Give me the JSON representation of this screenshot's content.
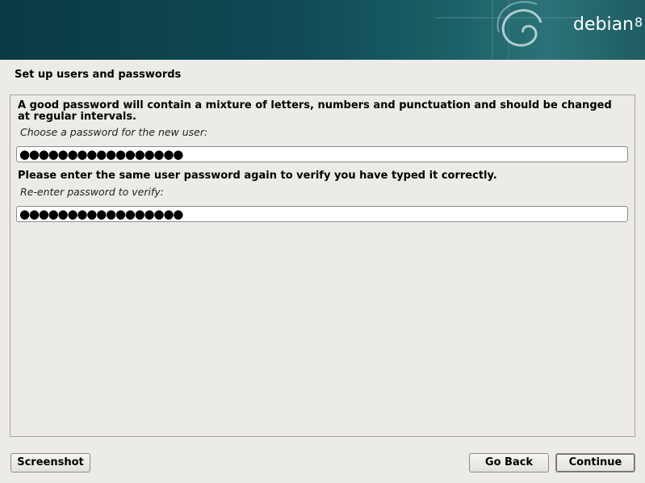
{
  "header": {
    "brand": "debian",
    "version": "8"
  },
  "page": {
    "title": "Set up users and passwords"
  },
  "form": {
    "password_hint": "A good password will contain a mixture of letters, numbers and punctuation and should be changed at regular intervals.",
    "password_prompt": "Choose a password for the new user:",
    "password_value": "●●●●●●●●●●●●●●●●●",
    "verify_hint": "Please enter the same user password again to verify you have typed it correctly.",
    "verify_prompt": "Re-enter password to verify:",
    "verify_value": "●●●●●●●●●●●●●●●●●"
  },
  "buttons": {
    "screenshot": "Screenshot",
    "go_back": "Go Back",
    "continue": "Continue"
  },
  "colors": {
    "banner": "#0f4a54",
    "background": "#edebe7"
  }
}
